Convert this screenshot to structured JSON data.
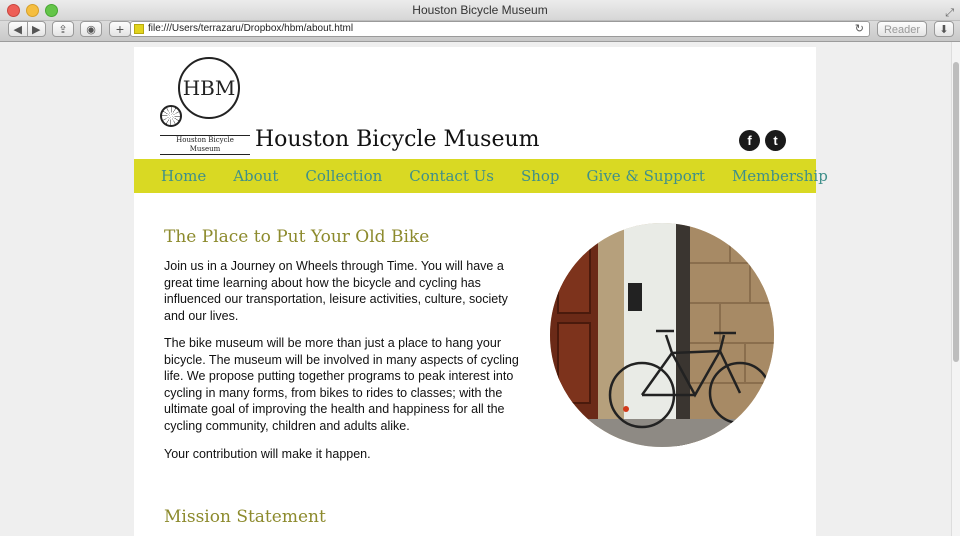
{
  "window": {
    "title": "Houston Bicycle Museum"
  },
  "toolbar": {
    "url": "file:///Users/terrazaru/Dropbox/hbm/about.html",
    "reader_label": "Reader",
    "back_glyph": "◀",
    "forward_glyph": "▶",
    "plus_glyph": "+"
  },
  "header": {
    "logo_text": "HBM",
    "logo_caption": "Houston Bicycle Museum",
    "site_title": "Houston Bicycle Museum",
    "social": [
      "f",
      "t"
    ]
  },
  "nav": {
    "items": [
      "Home",
      "About",
      "Collection",
      "Contact Us",
      "Shop",
      "Give & Support",
      "Membership"
    ]
  },
  "main": {
    "heading1": "The Place to Put Your Old Bike",
    "paragraphs": [
      "Join us in a Journey on Wheels through Time. You will have a great time learning about how the bicycle and cycling has influenced our transportation, leisure activities, culture, society and our lives.",
      "The bike museum will be more than just a place to hang your bicycle. The museum will be involved in many aspects of cycling life. We propose putting together programs to peak interest into cycling in many forms, from bikes to rides to classes; with the ultimate goal of improving the health and happiness for all the cycling community, children and adults alike.",
      "Your contribution will make it happen."
    ],
    "heading2": "Mission Statement"
  },
  "colors": {
    "nav_bg": "#d9d923",
    "nav_text": "#3f8f8a",
    "heading": "#8c8a2c"
  }
}
